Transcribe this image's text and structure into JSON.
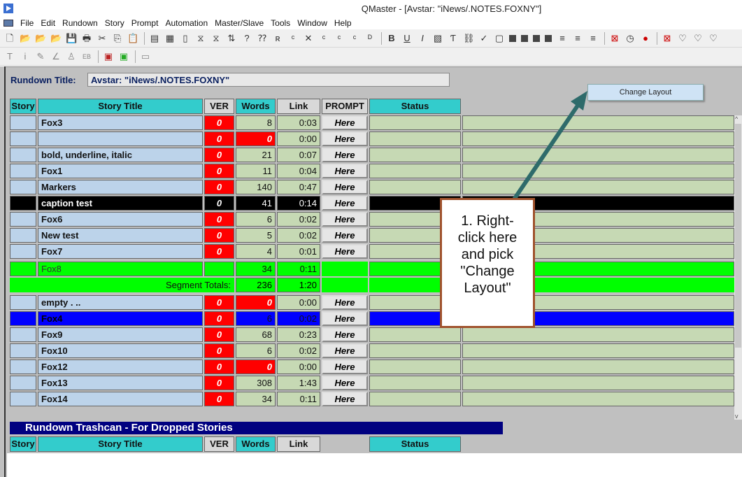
{
  "window": {
    "title": "QMaster - [Avstar: \"iNews/.NOTES.FOXNY\"]"
  },
  "menu": [
    "File",
    "Edit",
    "Rundown",
    "Story",
    "Prompt",
    "Automation",
    "Master/Slave",
    "Tools",
    "Window",
    "Help"
  ],
  "rundown": {
    "label": "Rundown Title:",
    "value": "Avstar: \"iNews/.NOTES.FOXNY\""
  },
  "context_menu": {
    "item": "Change Layout"
  },
  "columns": {
    "story": "Story",
    "title": "Story Title",
    "ver": "VER",
    "words": "Words",
    "link": "Link",
    "prompt": "PROMPT",
    "status": "Status"
  },
  "rows": [
    {
      "title": "Fox3",
      "ver": "0",
      "words": "8",
      "link": "0:03",
      "prompt": "Here",
      "style": "normal"
    },
    {
      "title": "",
      "ver": "0",
      "words": "0",
      "link": "0:00",
      "prompt": "Here",
      "style": "redwords"
    },
    {
      "title": "bold, underline, italic",
      "ver": "0",
      "words": "21",
      "link": "0:07",
      "prompt": "Here",
      "style": "normal"
    },
    {
      "title": "Fox1",
      "ver": "0",
      "words": "11",
      "link": "0:04",
      "prompt": "Here",
      "style": "normal"
    },
    {
      "title": "Markers",
      "ver": "0",
      "words": "140",
      "link": "0:47",
      "prompt": "Here",
      "style": "normal"
    },
    {
      "title": "caption test",
      "ver": "0",
      "words": "41",
      "link": "0:14",
      "prompt": "Here",
      "style": "selected"
    },
    {
      "title": "Fox6",
      "ver": "0",
      "words": "6",
      "link": "0:02",
      "prompt": "Here",
      "style": "normal"
    },
    {
      "title": "New test",
      "ver": "0",
      "words": "5",
      "link": "0:02",
      "prompt": "Here",
      "style": "normal"
    },
    {
      "title": "Fox7",
      "ver": "0",
      "words": "4",
      "link": "0:01",
      "prompt": "Here",
      "style": "normal"
    },
    {
      "title": "Fox8",
      "ver": "",
      "words": "34",
      "link": "0:11",
      "prompt": "",
      "style": "green"
    },
    {
      "title": "Segment Totals:",
      "ver": "",
      "words": "236",
      "link": "1:20",
      "prompt": "",
      "style": "total"
    },
    {
      "title": "empty           .        ..",
      "ver": "0",
      "words": "0",
      "link": "0:00",
      "prompt": "Here",
      "style": "redwords"
    },
    {
      "title": "Fox4",
      "ver": "0",
      "words": "6",
      "link": "0:02",
      "prompt": "Here",
      "style": "blue"
    },
    {
      "title": "Fox9",
      "ver": "0",
      "words": "68",
      "link": "0:23",
      "prompt": "Here",
      "style": "normal"
    },
    {
      "title": "Fox10",
      "ver": "0",
      "words": "6",
      "link": "0:02",
      "prompt": "Here",
      "style": "normal"
    },
    {
      "title": "Fox12",
      "ver": "0",
      "words": "0",
      "link": "0:00",
      "prompt": "Here",
      "style": "redwords"
    },
    {
      "title": "Fox13",
      "ver": "0",
      "words": "308",
      "link": "1:43",
      "prompt": "Here",
      "style": "normal"
    },
    {
      "title": "Fox14",
      "ver": "0",
      "words": "34",
      "link": "0:11",
      "prompt": "Here",
      "style": "normal"
    }
  ],
  "trashcan": {
    "title": "Rundown Trashcan - For Dropped Stories",
    "columns": {
      "story": "Story",
      "title": "Story Title",
      "ver": "VER",
      "words": "Words",
      "link": "Link",
      "status": "Status"
    }
  },
  "callout": {
    "lines": [
      "1. Right-",
      "click here",
      "and pick",
      "\"Change",
      "Layout\""
    ]
  },
  "colors": {
    "row_bg": "#bcd3ea",
    "rest_bg": "#c6d9b4",
    "header_bg": "#33cccc",
    "ver_bg": "#ff0000",
    "green": "#00ff00",
    "selected": "#000000",
    "blue": "#0000ff",
    "trash_bar": "#000080",
    "callout_border": "#a0522d",
    "arrow": "#2e6b6b"
  }
}
